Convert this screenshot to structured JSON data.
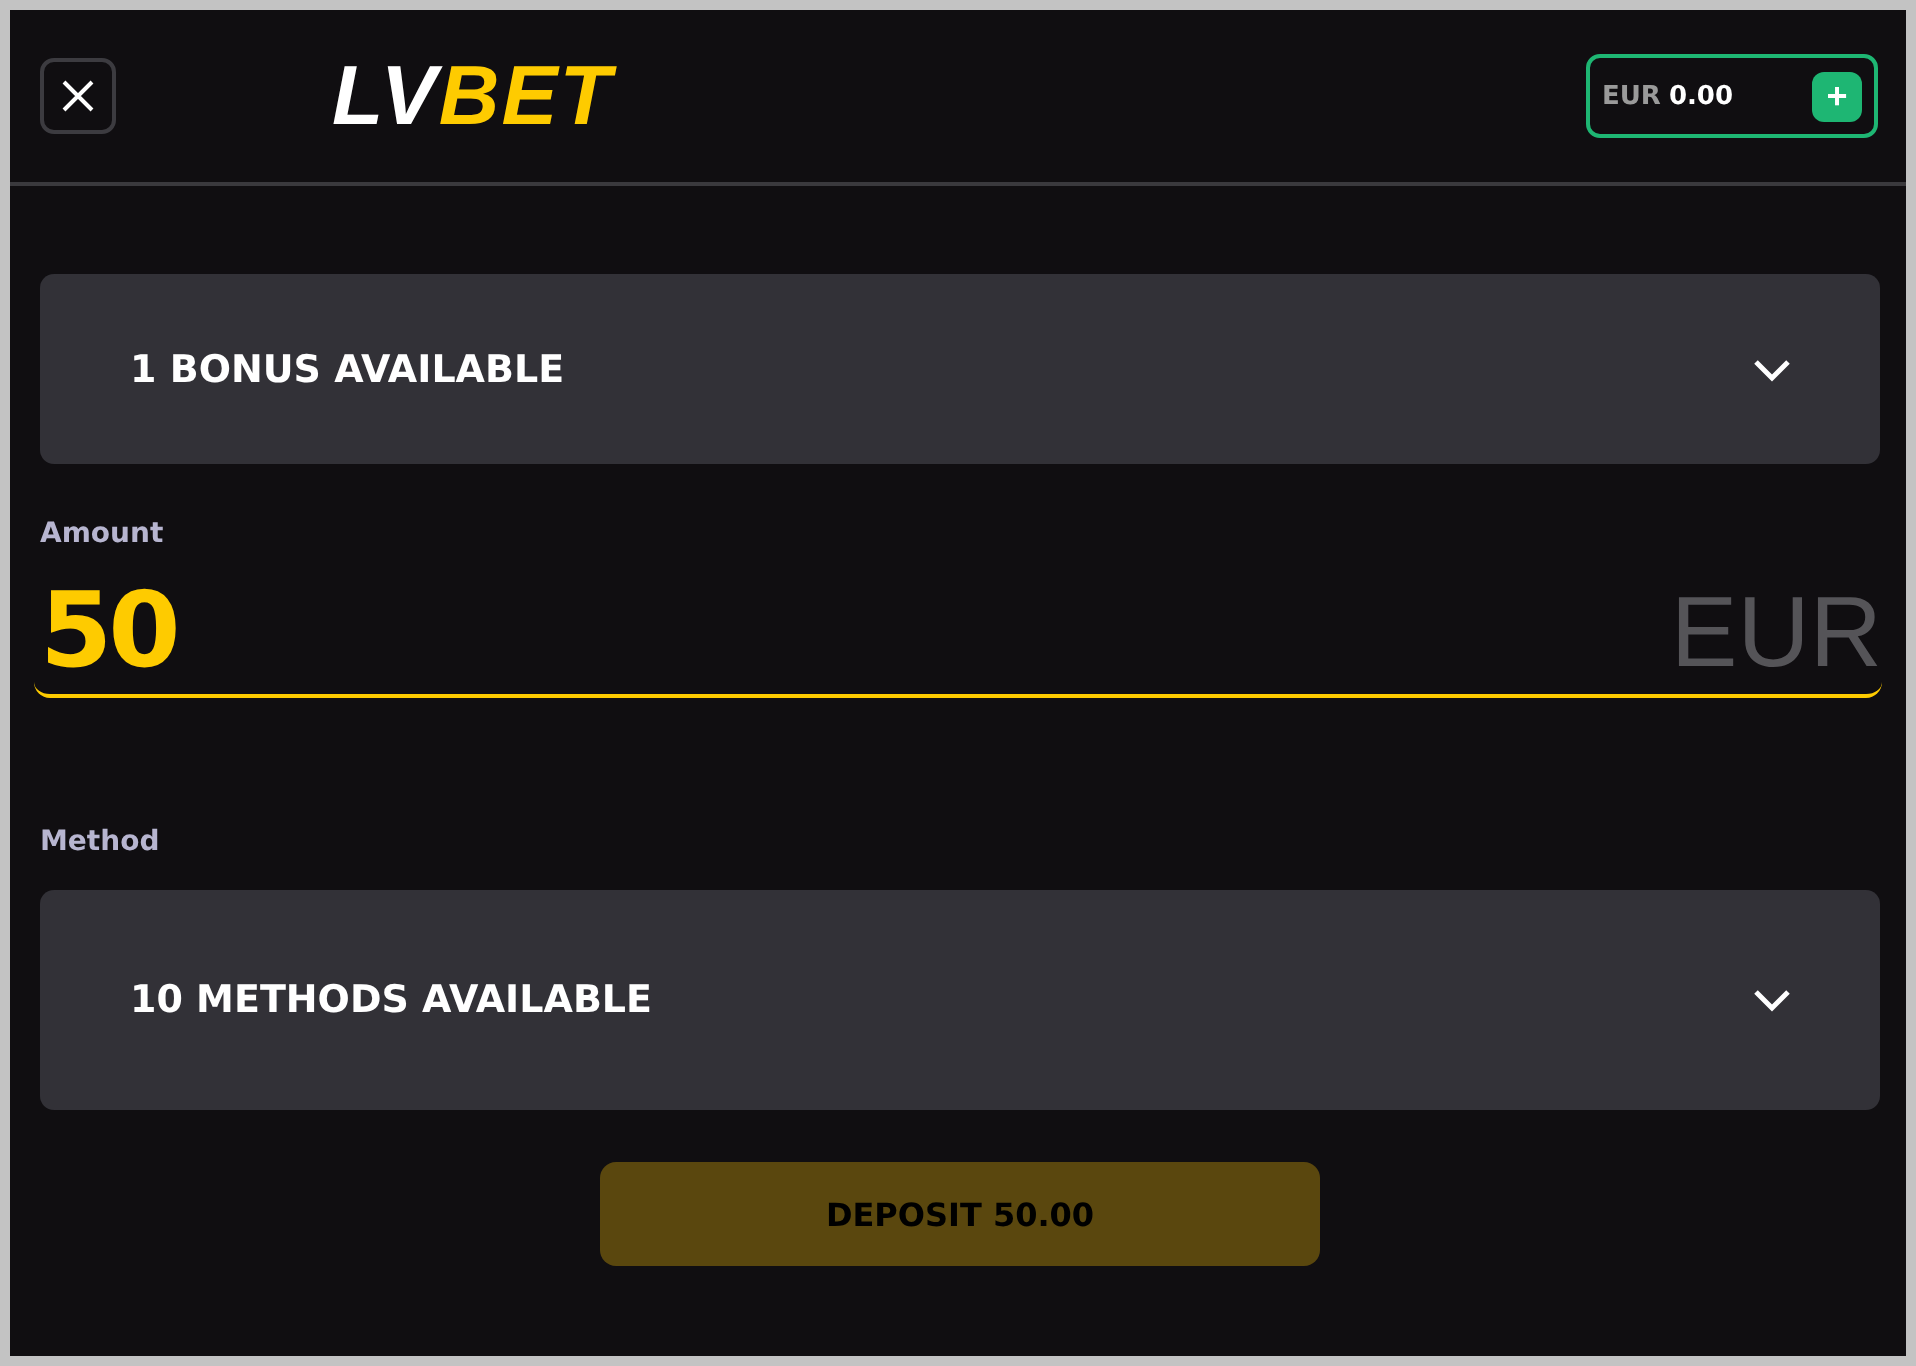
{
  "header": {
    "logo": {
      "part_1": "LV",
      "part_2": "BET"
    },
    "balance": {
      "currency": "EUR",
      "amount": "0.00",
      "add_label": "+"
    }
  },
  "bonus_dropdown": {
    "label": "1 BONUS AVAILABLE",
    "expanded": false
  },
  "amount": {
    "label": "Amount",
    "value": "50",
    "currency": "EUR"
  },
  "method": {
    "label": "Method",
    "dropdown": {
      "label": "10 METHODS AVAILABLE",
      "expanded": false
    }
  },
  "deposit_button": {
    "label": "DEPOSIT 50.00",
    "disabled": true
  }
}
